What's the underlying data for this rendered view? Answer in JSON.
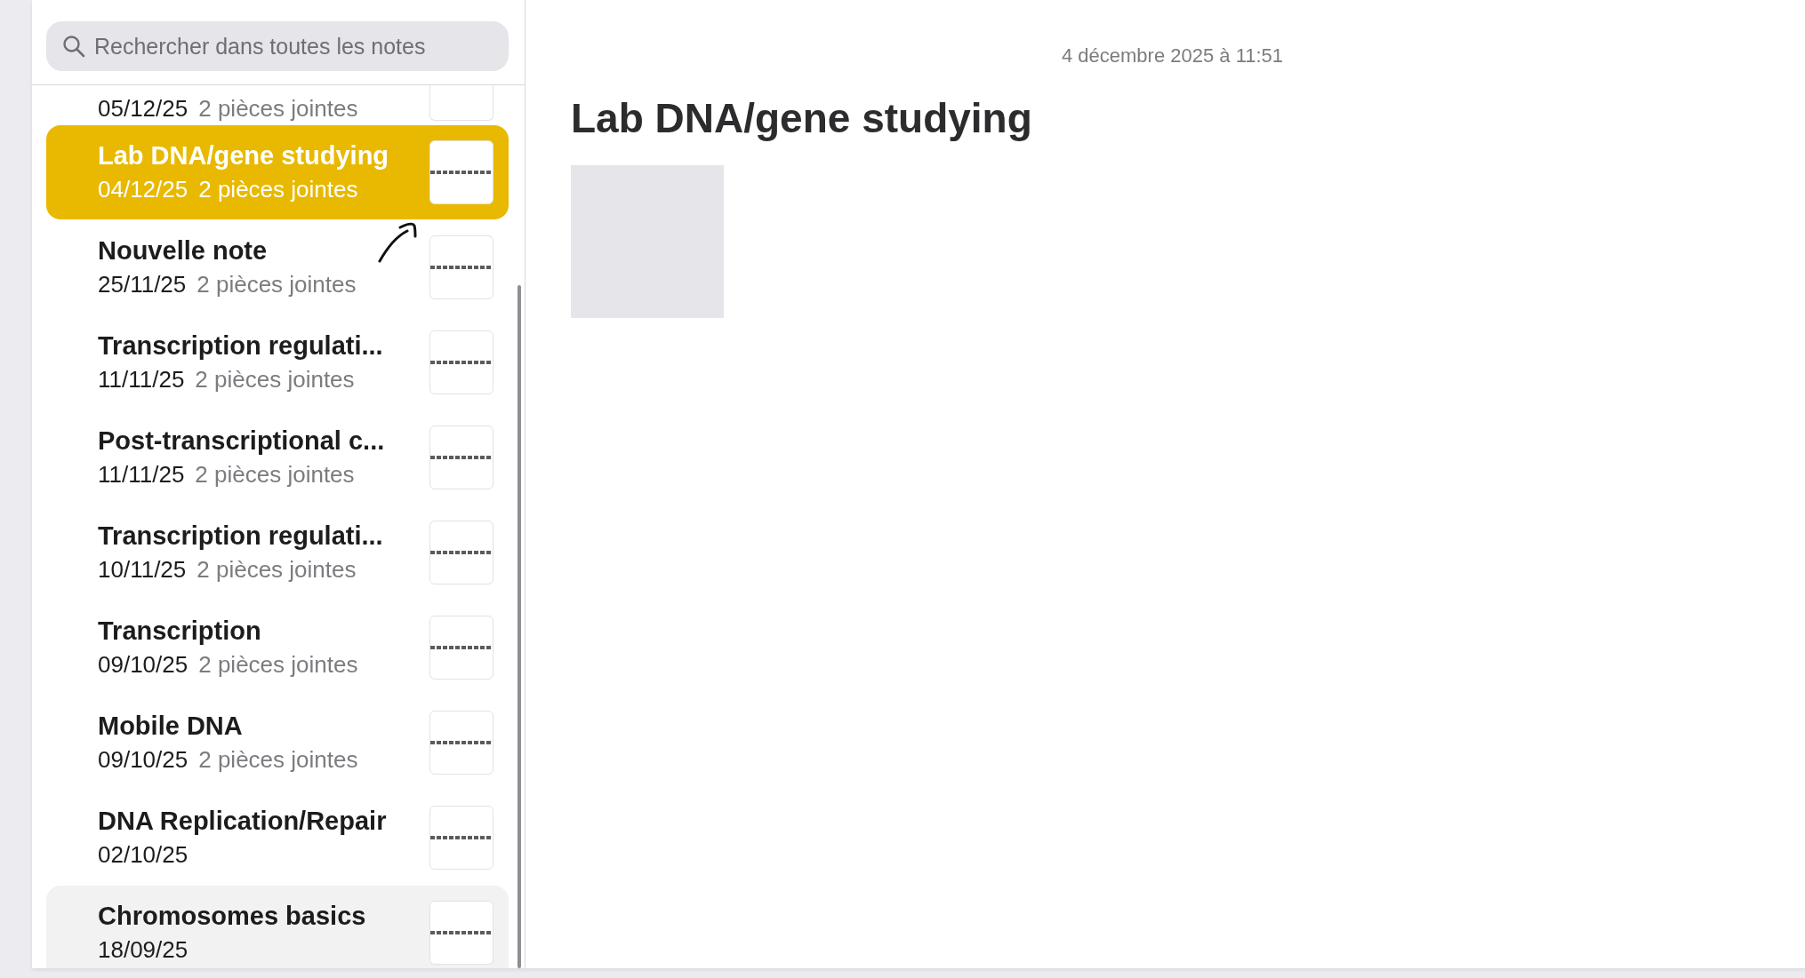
{
  "search": {
    "placeholder": "Rechercher dans toutes les notes"
  },
  "notes": [
    {
      "date": "05/12/25",
      "attachments": "2 pièces jointes",
      "selected": false,
      "hovered": false
    },
    {
      "title": "Lab DNA/gene studying",
      "date": "04/12/25",
      "attachments": "2 pièces jointes",
      "selected": true,
      "hovered": false
    },
    {
      "title": "Nouvelle note",
      "date": "25/11/25",
      "attachments": "2 pièces jointes",
      "selected": false,
      "hovered": false
    },
    {
      "title": "Transcription regulati...",
      "date": "11/11/25",
      "attachments": "2 pièces jointes",
      "selected": false,
      "hovered": false
    },
    {
      "title": "Post-transcriptional c...",
      "date": "11/11/25",
      "attachments": "2 pièces jointes",
      "selected": false,
      "hovered": false
    },
    {
      "title": "Transcription regulati...",
      "date": "10/11/25",
      "attachments": "2 pièces jointes",
      "selected": false,
      "hovered": false
    },
    {
      "title": "Transcription",
      "date": "09/10/25",
      "attachments": "2 pièces jointes",
      "selected": false,
      "hovered": false
    },
    {
      "title": "Mobile DNA",
      "date": "09/10/25",
      "attachments": "2 pièces jointes",
      "selected": false,
      "hovered": false
    },
    {
      "title": "DNA Replication/Repair",
      "date": "02/10/25",
      "selected": false,
      "hovered": false
    },
    {
      "title": "Chromosomes basics",
      "date": "18/09/25",
      "selected": false,
      "hovered": true
    }
  ],
  "note": {
    "timestamp": "4 décembre 2025 à 11:51",
    "title": "Lab DNA/gene studying"
  }
}
